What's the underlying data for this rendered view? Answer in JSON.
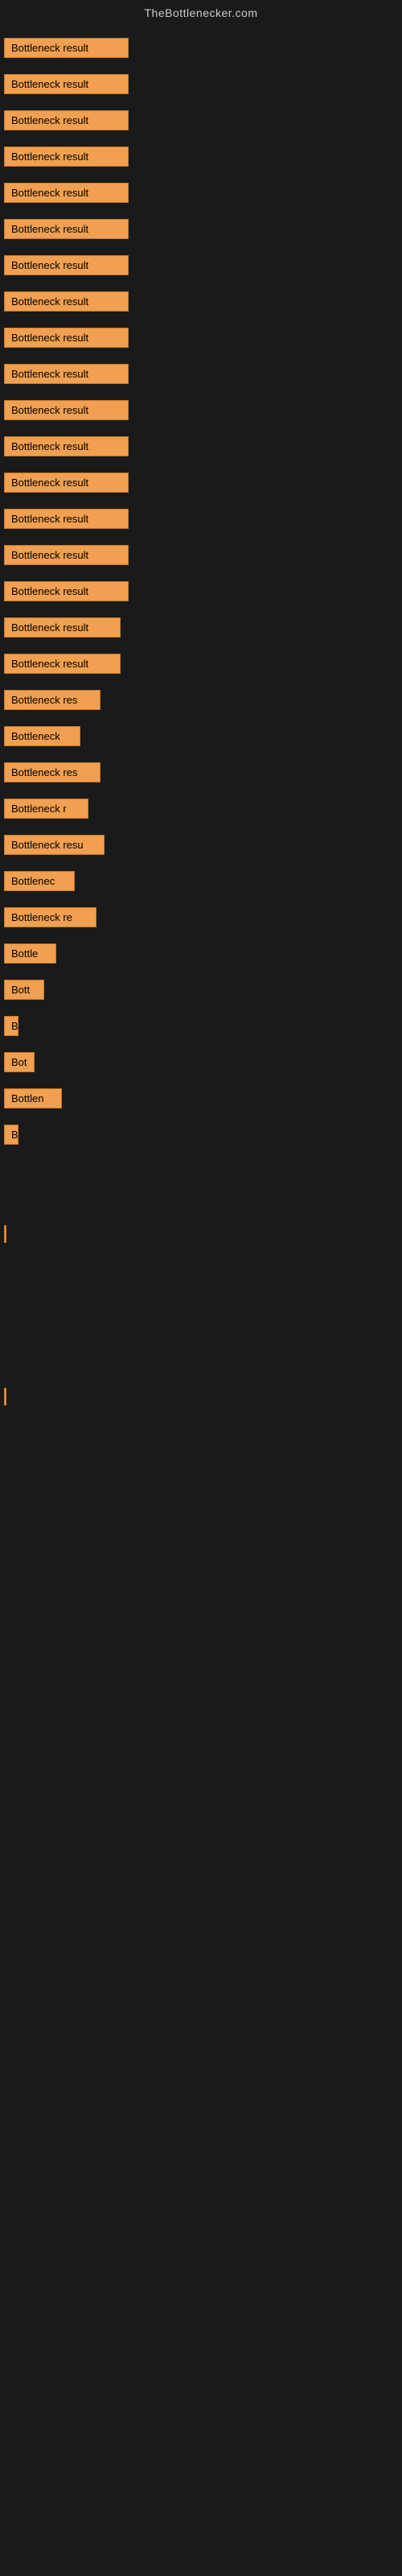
{
  "site": {
    "title": "TheBottlenecker.com"
  },
  "rows": [
    {
      "label": "Bottleneck result",
      "width": 155
    },
    {
      "label": "Bottleneck result",
      "width": 155
    },
    {
      "label": "Bottleneck result",
      "width": 155
    },
    {
      "label": "Bottleneck result",
      "width": 155
    },
    {
      "label": "Bottleneck result",
      "width": 155
    },
    {
      "label": "Bottleneck result",
      "width": 155
    },
    {
      "label": "Bottleneck result",
      "width": 155
    },
    {
      "label": "Bottleneck result",
      "width": 155
    },
    {
      "label": "Bottleneck result",
      "width": 155
    },
    {
      "label": "Bottleneck result",
      "width": 155
    },
    {
      "label": "Bottleneck result",
      "width": 155
    },
    {
      "label": "Bottleneck result",
      "width": 155
    },
    {
      "label": "Bottleneck result",
      "width": 155
    },
    {
      "label": "Bottleneck result",
      "width": 155
    },
    {
      "label": "Bottleneck result",
      "width": 155
    },
    {
      "label": "Bottleneck result",
      "width": 155
    },
    {
      "label": "Bottleneck result",
      "width": 145
    },
    {
      "label": "Bottleneck result",
      "width": 145
    },
    {
      "label": "Bottleneck res",
      "width": 120
    },
    {
      "label": "Bottleneck",
      "width": 95
    },
    {
      "label": "Bottleneck res",
      "width": 120
    },
    {
      "label": "Bottleneck r",
      "width": 105
    },
    {
      "label": "Bottleneck resu",
      "width": 125
    },
    {
      "label": "Bottlenec",
      "width": 88
    },
    {
      "label": "Bottleneck re",
      "width": 115
    },
    {
      "label": "Bottle",
      "width": 65
    },
    {
      "label": "Bott",
      "width": 50
    },
    {
      "label": "B",
      "width": 18
    },
    {
      "label": "Bot",
      "width": 38
    },
    {
      "label": "Bottlen",
      "width": 72
    },
    {
      "label": "B",
      "width": 18
    },
    {
      "label": "",
      "width": 0
    },
    {
      "label": "",
      "width": 0
    },
    {
      "label": "|",
      "width": 8
    },
    {
      "label": "",
      "width": 0
    },
    {
      "label": "",
      "width": 0
    },
    {
      "label": "",
      "width": 0
    },
    {
      "label": "",
      "width": 0
    },
    {
      "label": "|",
      "width": 8
    }
  ],
  "colors": {
    "background": "#1a1a1a",
    "bar": "#f0a050",
    "bar_border": "#c87820",
    "text_light": "#cccccc",
    "text_dark": "#000000"
  }
}
